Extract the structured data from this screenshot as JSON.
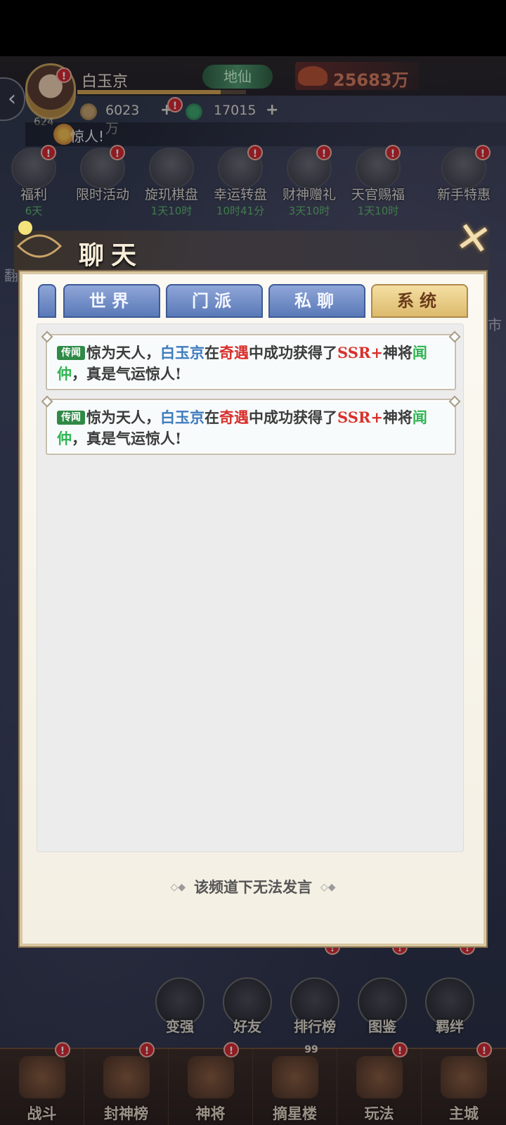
{
  "hud": {
    "player_name": "白玉京",
    "avatar_level": "624",
    "rank": "地仙",
    "power": "25683万",
    "gold": "6023万",
    "jade": "17015",
    "plus": "+",
    "ticker": "惊人!",
    "badge_mark": "!"
  },
  "activities": [
    {
      "label": "福利",
      "timer": "6天"
    },
    {
      "label": "限时活动",
      "timer": ""
    },
    {
      "label": "旋玑棋盘",
      "timer": "1天10时"
    },
    {
      "label": "幸运转盘",
      "timer": "10时41分"
    },
    {
      "label": "财神赠礼",
      "timer": "3天10时"
    },
    {
      "label": "天官赐福",
      "timer": "1天10时"
    },
    {
      "label": "新手特惠",
      "timer": ""
    }
  ],
  "side": {
    "left_partial": "翻",
    "right_partial": "市"
  },
  "chat": {
    "title": "聊天",
    "close_icon": "✕",
    "tabs": [
      "世界",
      "门派",
      "私聊",
      "系统"
    ],
    "active_tab": "系统",
    "messages": [
      {
        "tag": "传闻",
        "p1": "惊为天人，",
        "player": "白玉京",
        "p2": "在",
        "source": "奇遇",
        "p3": "中成功获得了",
        "rarity": "SSR+",
        "p4": "神将",
        "hero": "闻仲",
        "p5": "，真是气运惊人!"
      },
      {
        "tag": "传闻",
        "p1": "惊为天人，",
        "player": "白玉京",
        "p2": "在",
        "source": "奇遇",
        "p3": "中成功获得了",
        "rarity": "SSR+",
        "p4": "神将",
        "hero": "闻仲",
        "p5": "，真是气运惊人!"
      }
    ],
    "footer": "该频道下无法发言"
  },
  "quick_actions": [
    "变强",
    "好友",
    "排行榜",
    "图鉴",
    "羁绊"
  ],
  "bottom_nav": [
    {
      "label": "战斗",
      "badge": "!"
    },
    {
      "label": "封神榜",
      "badge": "!"
    },
    {
      "label": "神将",
      "badge": "!"
    },
    {
      "label": "摘星楼",
      "badge": "99"
    },
    {
      "label": "玩法",
      "badge": "!"
    },
    {
      "label": "主城",
      "badge": "!"
    }
  ]
}
